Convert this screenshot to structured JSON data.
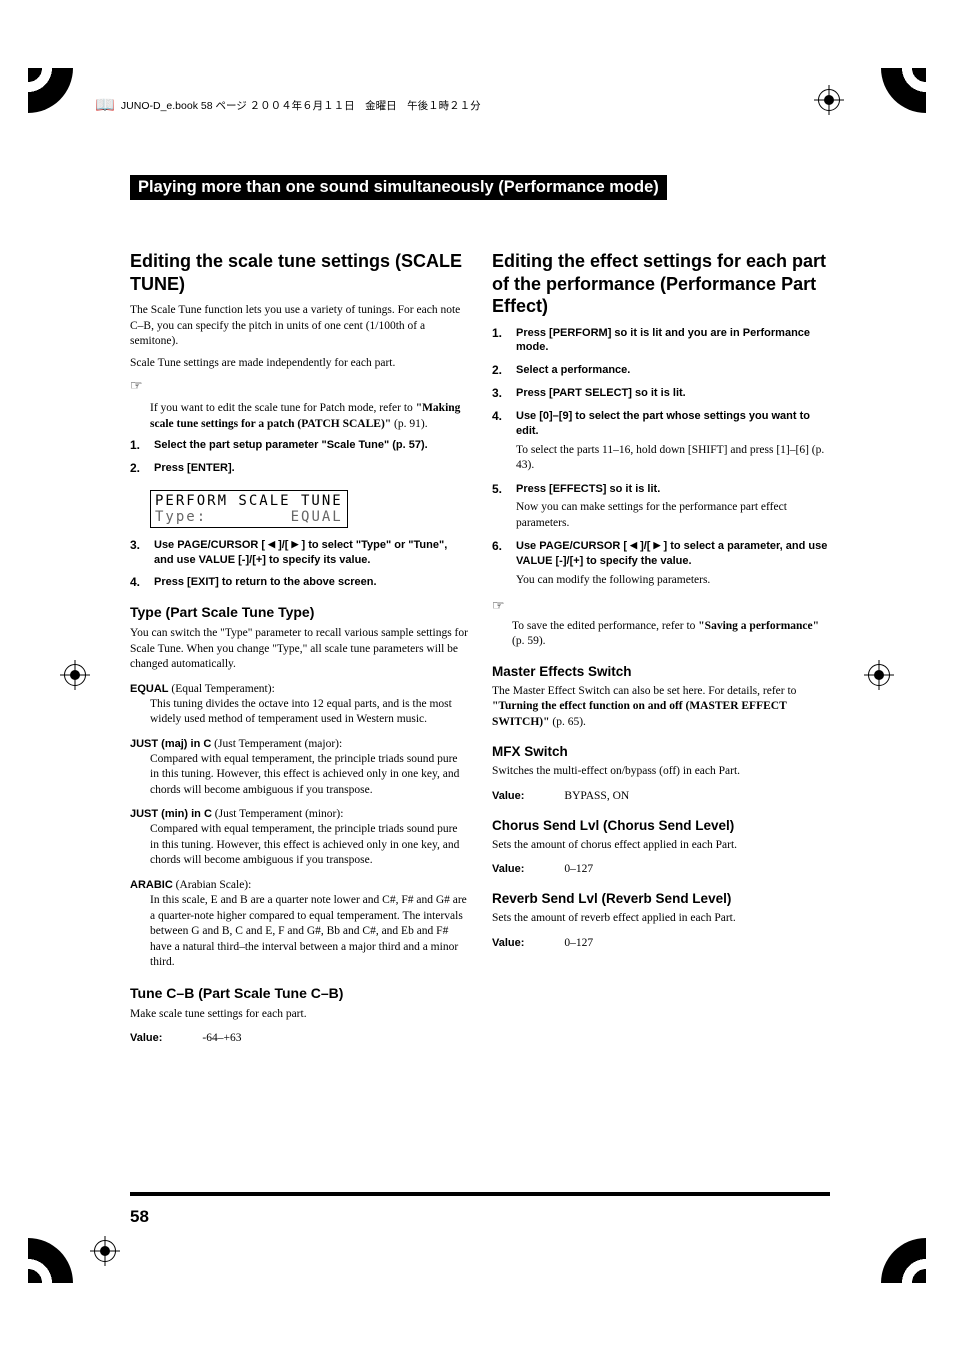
{
  "header": {
    "filename": "JUNO-D_e.book 58 ページ ２００４年６月１１日　金曜日　午後１時２１分"
  },
  "section_title": "Playing more than one sound simultaneously (Performance mode)",
  "left": {
    "h2": "Editing the scale tune settings (SCALE TUNE)",
    "intro1": "The Scale Tune function lets you use a variety of tunings. For each note C–B, you can specify the pitch in units of one cent (1/100th of a semitone).",
    "intro2": "Scale Tune settings are made independently for each part.",
    "note1a": "If you want to edit the scale tune for Patch mode, refer to ",
    "note1b": "\"Making scale tune settings for a patch (PATCH SCALE)\"",
    "note1c": " (p. 91).",
    "steps": [
      {
        "num": "1.",
        "text": "Select the part setup parameter \"Scale Tune\" (p. 57)."
      },
      {
        "num": "2.",
        "text": "Press [ENTER]."
      }
    ],
    "lcd": {
      "row1": "PERFORM SCALE TUNE",
      "row2_left": "Type:",
      "row2_right": "EQUAL"
    },
    "step3_pre": "Use PAGE/CURSOR [ ",
    "step3_mid": " ]/[ ",
    "step3_post": " ] to select \"Type\" or \"Tune\", and use VALUE [-]/[+] to specify its value.",
    "step3_num": "3.",
    "step4_num": "4.",
    "step4": "Press [EXIT] to return to the above screen.",
    "type_h3": "Type (Part Scale Tune Type)",
    "type_intro": "You can switch the \"Type\" parameter to recall various sample settings for Scale Tune. When you change \"Type,\" all scale tune parameters will be changed automatically.",
    "defs": [
      {
        "name": "EQUAL",
        "rest": " (Equal Temperament):",
        "desc": "This tuning divides the octave into 12 equal parts, and is the most widely used method of temperament used in Western music."
      },
      {
        "name": "JUST (maj) in C",
        "rest": " (Just Temperament (major):",
        "desc": "Compared with equal temperament, the principle triads sound pure in this tuning. However, this effect is achieved only in one key, and chords will become ambiguous if you transpose."
      },
      {
        "name": "JUST (min) in C",
        "rest": " (Just Temperament (minor):",
        "desc": "Compared with equal temperament, the principle triads sound pure in this tuning. However, this effect is achieved only in one key, and chords will become ambiguous if you transpose."
      },
      {
        "name": "ARABIC",
        "rest": " (Arabian Scale):",
        "desc": "In this scale, E and B are a quarter note lower and C#, F# and G# are a quarter-note higher compared to equal temperament. The intervals between G and B, C and E, F and G#, Bb and C#, and Eb and F# have a natural third–the interval between a major third and a minor third."
      }
    ],
    "tune_h3": "Tune C–B (Part Scale Tune C–B)",
    "tune_desc": "Make scale tune settings for each part.",
    "tune_value_label": "Value:",
    "tune_value": "-64–+63"
  },
  "right": {
    "h2": "Editing the effect settings for each part of the performance (Performance Part Effect)",
    "steps": [
      {
        "num": "1.",
        "text": "Press [PERFORM] so it is lit and you are in Performance mode."
      },
      {
        "num": "2.",
        "text": "Select a performance."
      },
      {
        "num": "3.",
        "text": "Press [PART SELECT] so it is lit."
      },
      {
        "num": "4.",
        "text": "Use [0]–[9] to select the part whose settings you want to edit.",
        "note": "To select the parts 11–16, hold down [SHIFT] and press [1]–[6] (p. 43)."
      },
      {
        "num": "5.",
        "text": "Press [EFFECTS] so it is lit.",
        "note": "Now you can make settings for the performance part effect parameters."
      }
    ],
    "step6_num": "6.",
    "step6_pre": "Use PAGE/CURSOR [ ",
    "step6_mid": " ]/[ ",
    "step6_post": " ] to select a parameter, and use VALUE [-]/[+] to specify the value.",
    "step6_note": "You can modify the following parameters.",
    "save_a": "To save the edited performance, refer to ",
    "save_b": "\"Saving a performance\"",
    "save_c": " (p. 59).",
    "mes_h3": "Master Effects Switch",
    "mes_desc_a": "The Master Effect Switch can also be set here. For details, refer to ",
    "mes_desc_b": "\"Turning the effect function on and off (MASTER EFFECT SWITCH)\"",
    "mes_desc_c": " (p. 65).",
    "mfx_h3": "MFX Switch",
    "mfx_desc": "Switches the multi-effect on/bypass (off) in each Part.",
    "mfx_value_label": "Value:",
    "mfx_value": "BYPASS, ON",
    "chorus_h3": "Chorus Send Lvl (Chorus Send Level)",
    "chorus_desc": "Sets the amount of chorus effect applied in each Part.",
    "chorus_value_label": "Value:",
    "chorus_value": "0–127",
    "reverb_h3": "Reverb Send Lvl (Reverb Send Level)",
    "reverb_desc": "Sets the amount of reverb effect applied in each Part.",
    "reverb_value_label": "Value:",
    "reverb_value": "0–127"
  },
  "page_number": "58"
}
